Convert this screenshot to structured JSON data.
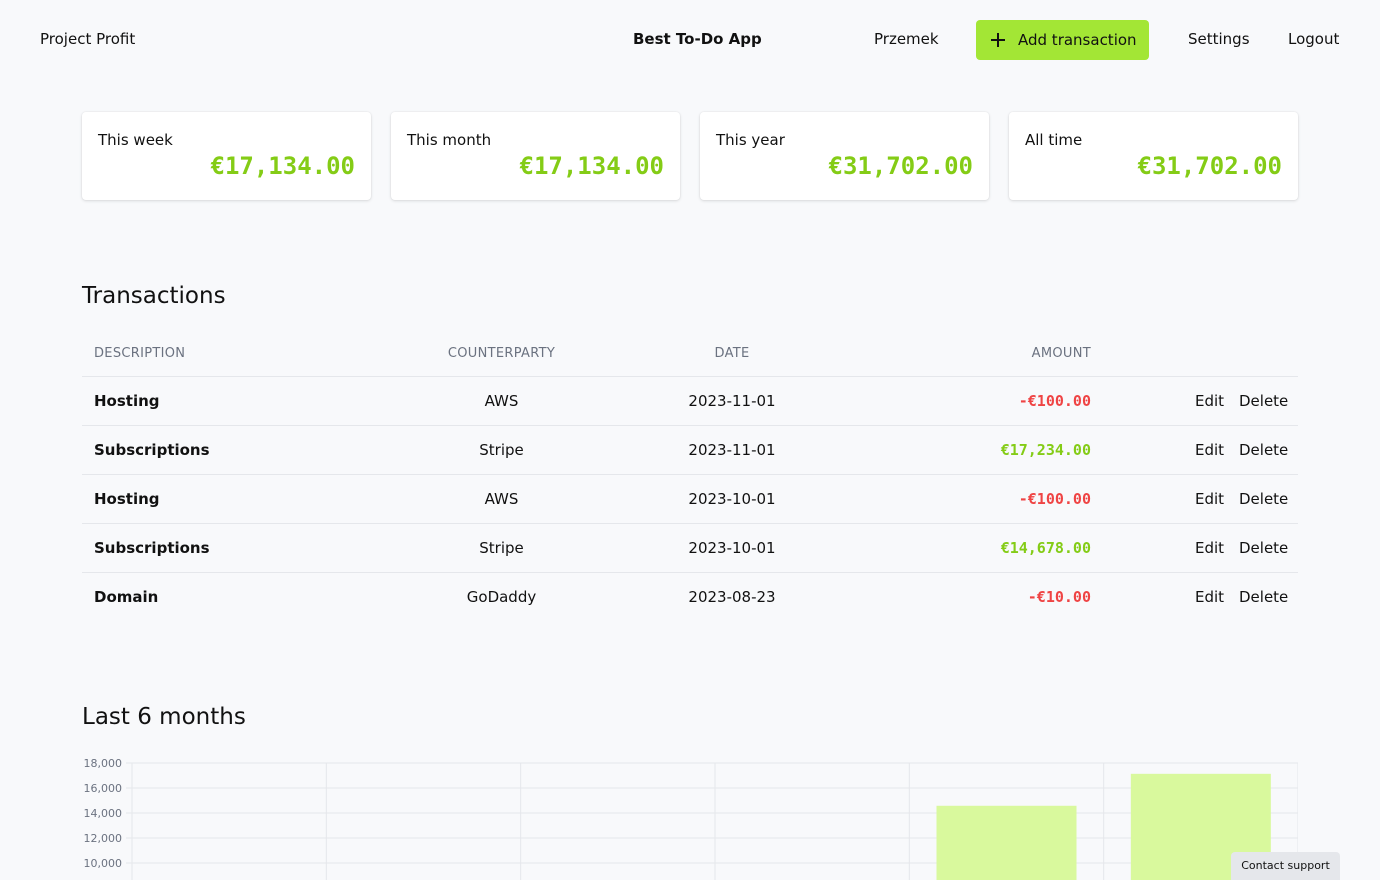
{
  "header": {
    "brand": "Project Profit",
    "project": "Best To-Do App",
    "user": "Przemek",
    "add_label": "Add transaction",
    "settings": "Settings",
    "logout": "Logout"
  },
  "stats": [
    {
      "label": "This week",
      "value": "€17,134.00"
    },
    {
      "label": "This month",
      "value": "€17,134.00"
    },
    {
      "label": "This year",
      "value": "€31,702.00"
    },
    {
      "label": "All time",
      "value": "€31,702.00"
    }
  ],
  "transactions": {
    "title": "Transactions",
    "columns": {
      "description": "DESCRIPTION",
      "counterparty": "COUNTERPARTY",
      "date": "DATE",
      "amount": "AMOUNT"
    },
    "edit_label": "Edit",
    "delete_label": "Delete",
    "rows": [
      {
        "description": "Hosting",
        "counterparty": "AWS",
        "date": "2023-11-01",
        "amount": "-€100.00",
        "sign": "neg"
      },
      {
        "description": "Subscriptions",
        "counterparty": "Stripe",
        "date": "2023-11-01",
        "amount": "€17,234.00",
        "sign": "pos"
      },
      {
        "description": "Hosting",
        "counterparty": "AWS",
        "date": "2023-10-01",
        "amount": "-€100.00",
        "sign": "neg"
      },
      {
        "description": "Subscriptions",
        "counterparty": "Stripe",
        "date": "2023-10-01",
        "amount": "€14,678.00",
        "sign": "pos"
      },
      {
        "description": "Domain",
        "counterparty": "GoDaddy",
        "date": "2023-08-23",
        "amount": "-€10.00",
        "sign": "neg"
      }
    ]
  },
  "chart_section": {
    "title": "Last 6 months"
  },
  "chart_data": {
    "type": "bar",
    "categories": [
      "",
      "",
      "",
      "",
      "",
      ""
    ],
    "values": [
      0,
      0,
      0,
      0,
      14578,
      17134
    ],
    "yticks": [
      "18,000",
      "16,000",
      "14,000",
      "12,000",
      "10,000"
    ],
    "ytick_values": [
      18000,
      16000,
      14000,
      12000,
      10000
    ],
    "grid": true,
    "bar_color": "#d9f99d"
  },
  "support_label": "Contact support",
  "colors": {
    "accent": "#a3e635",
    "positive": "#84cc16",
    "negative": "#ef4444"
  }
}
